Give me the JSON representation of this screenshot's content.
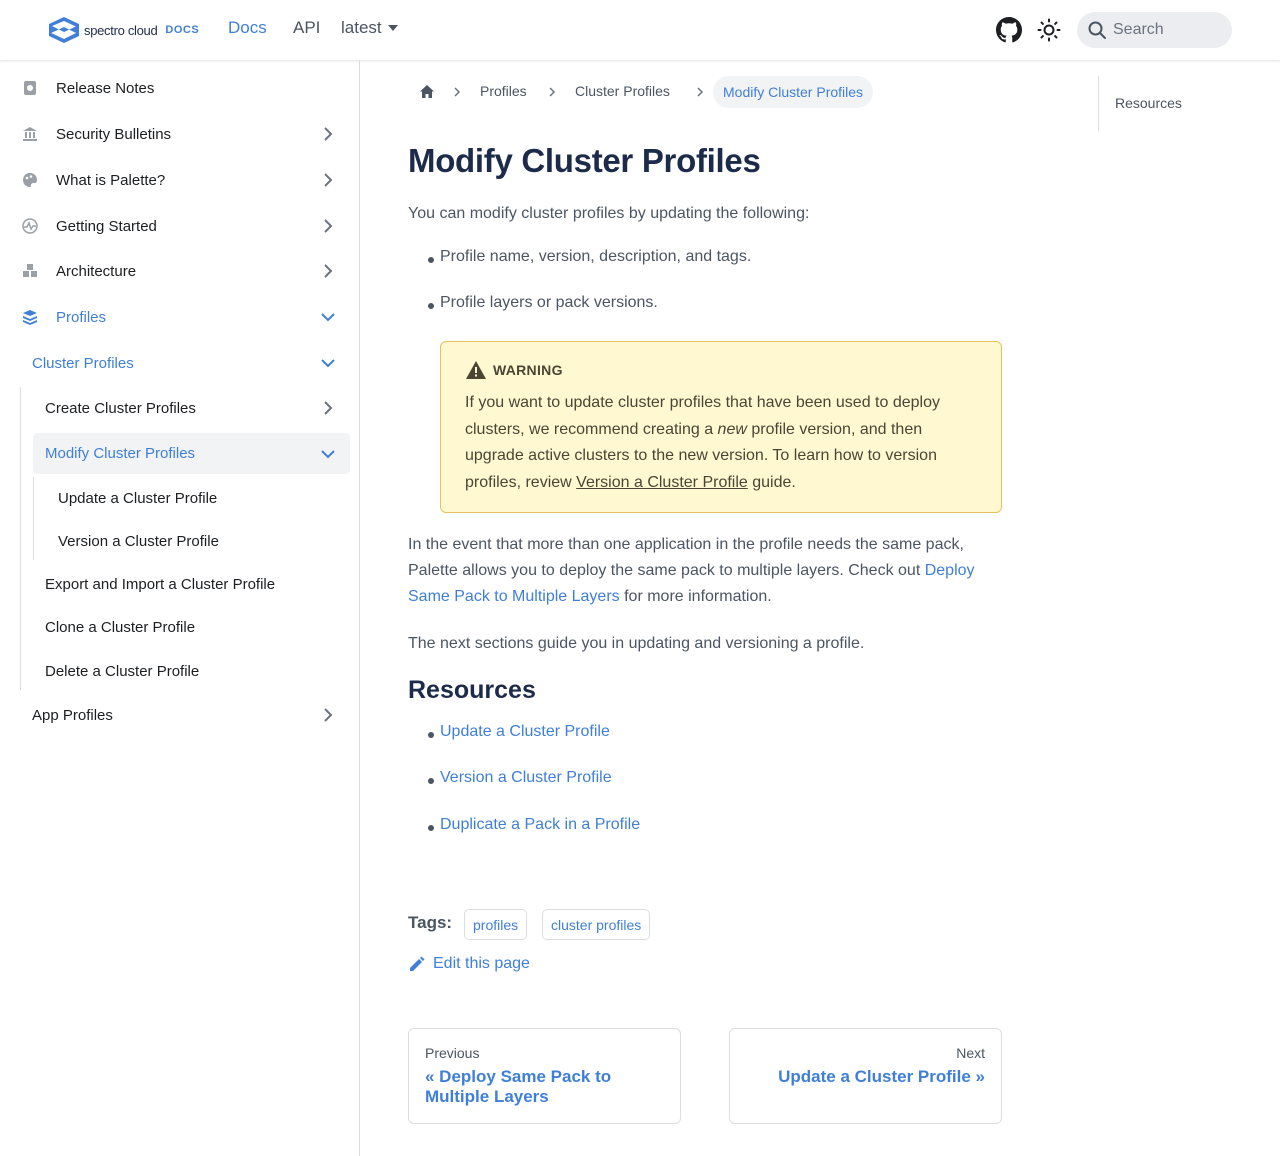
{
  "navbar": {
    "logo_text": "spectro cloud",
    "logo_docs": "DOCS",
    "links": {
      "docs": "Docs",
      "api": "API",
      "version": "latest"
    },
    "search_placeholder": "Search"
  },
  "sidebar": {
    "items": [
      {
        "label": "Release Notes",
        "icon": "release-notes-icon"
      },
      {
        "label": "Security Bulletins",
        "icon": "bank-icon"
      },
      {
        "label": "What is Palette?",
        "icon": "palette-icon"
      },
      {
        "label": "Getting Started",
        "icon": "pulse-icon"
      },
      {
        "label": "Architecture",
        "icon": "cubes-icon"
      },
      {
        "label": "Profiles",
        "icon": "layers-icon"
      }
    ],
    "profiles_children": {
      "cluster_profiles": "Cluster Profiles",
      "create": "Create Cluster Profiles",
      "modify": "Modify Cluster Profiles",
      "update": "Update a Cluster Profile",
      "version": "Version a Cluster Profile",
      "export_import": "Export and Import a Cluster Profile",
      "clone": "Clone a Cluster Profile",
      "delete": "Delete a Cluster Profile",
      "app_profiles": "App Profiles"
    }
  },
  "breadcrumb": {
    "items": [
      "Profiles",
      "Cluster Profiles"
    ],
    "current": "Modify Cluster Profiles"
  },
  "content": {
    "title": "Modify Cluster Profiles",
    "intro": "You can modify cluster profiles by updating the following:",
    "bullets": [
      "Profile name, version, description, and tags.",
      "Profile layers or pack versions."
    ],
    "warning": {
      "heading": "WARNING",
      "text_1": "If you want to update cluster profiles that have been used to deploy clusters, we recommend creating a ",
      "text_em": "new",
      "text_2": " profile version, and then upgrade active clusters to the new version. To learn how to version profiles, review ",
      "link": "Version a Cluster Profile",
      "text_3": " guide."
    },
    "para2_1": "In the event that more than one application in the profile needs the same pack, Palette allows you to deploy the same pack to multiple layers. Check out ",
    "para2_link": "Deploy Same Pack to Multiple Layers",
    "para2_2": " for more information.",
    "para3": "The next sections guide you in updating and versioning a profile.",
    "resources_heading": "Resources",
    "resources": [
      "Update a Cluster Profile",
      "Version a Cluster Profile",
      "Duplicate a Pack in a Profile"
    ]
  },
  "tags": {
    "label": "Tags:",
    "items": [
      "profiles",
      "cluster profiles"
    ]
  },
  "edit_label": "Edit this page",
  "pager": {
    "prev_sub": "Previous",
    "prev_label": "« Deploy Same Pack to Multiple Layers",
    "next_sub": "Next",
    "next_label": "Update a Cluster Profile »"
  },
  "toc": {
    "items": [
      "Resources"
    ]
  },
  "colors": {
    "accent": "#3f7fd8",
    "heading": "#1c2b4a",
    "warning_bg": "#fff8d1",
    "warning_border": "#e5c25c"
  }
}
